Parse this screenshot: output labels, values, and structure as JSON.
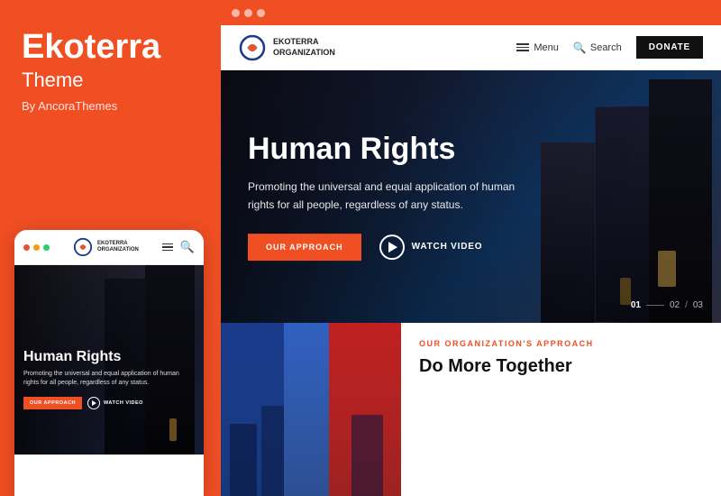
{
  "left": {
    "brand_title": "Ekoterra",
    "brand_subtitle": "Theme",
    "brand_by": "By AncoraThemes",
    "mobile": {
      "dots": [
        "dot1",
        "dot2",
        "dot3"
      ],
      "logo_line1": "EKOTERRA",
      "logo_line2": "ORGANIZATION",
      "hero_title": "Human Rights",
      "hero_desc": "Promoting the universal and equal application of human rights for all people, regardless of any status.",
      "btn_approach": "OUR APPROACH",
      "btn_video": "Watch VIdEo"
    }
  },
  "right": {
    "browser_dots": [
      "dot1",
      "dot2",
      "dot3"
    ],
    "nav": {
      "logo_line1": "EKOTERRA",
      "logo_line2": "ORGANIZATION",
      "menu_label": "Menu",
      "search_label": "Search",
      "donate_label": "DONATE"
    },
    "hero": {
      "title": "Human Rights",
      "description": "Promoting the universal and equal application of human rights for all people, regardless of any status.",
      "btn_approach": "OUR APPROACH",
      "btn_video": "WATCH VIDEO",
      "slide_current": "01",
      "slide_sep": "/",
      "slide_next": "02",
      "slide_last": "03"
    },
    "bottom": {
      "label": "OUR ORGANIZATION'S APPROACH",
      "heading": "Do More Together"
    }
  }
}
